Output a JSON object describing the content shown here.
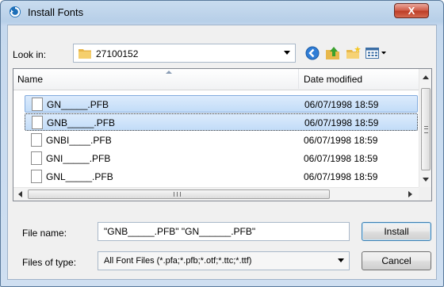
{
  "window": {
    "title": "Install Fonts",
    "close_glyph": "X",
    "app_icon": "install-fonts-icon"
  },
  "toolbar": {
    "look_in_label": "Look in:",
    "look_in_value": "27100152",
    "folder_icon": "folder-icon",
    "buttons": [
      "back-icon",
      "up-folder-icon",
      "new-folder-icon",
      "views-icon"
    ]
  },
  "list": {
    "columns": [
      "Name",
      "Date modified"
    ],
    "files": [
      {
        "name": "GN_____.PFB",
        "date": "06/07/1998 18:59",
        "selected": true,
        "focused": false
      },
      {
        "name": "GNB_____.PFB",
        "date": "06/07/1998 18:59",
        "selected": true,
        "focused": true
      },
      {
        "name": "GNBI____.PFB",
        "date": "06/07/1998 18:59",
        "selected": false,
        "focused": false
      },
      {
        "name": "GNI_____.PFB",
        "date": "06/07/1998 18:59",
        "selected": false,
        "focused": false
      },
      {
        "name": "GNL_____.PFB",
        "date": "06/07/1998 18:59",
        "selected": false,
        "focused": false
      }
    ]
  },
  "footer": {
    "file_name_label": "File name:",
    "file_name_value": "\"GNB_____.PFB\" \"GN______.PFB\"",
    "file_type_label": "Files of type:",
    "file_type_value": "All Font Files (*.pfa;*.pfb;*.otf;*.ttc;*.ttf)",
    "install_label": "Install",
    "cancel_label": "Cancel"
  },
  "colors": {
    "selection": "#cfe3fa",
    "accent": "#3c7fb1",
    "close": "#c9462f"
  }
}
